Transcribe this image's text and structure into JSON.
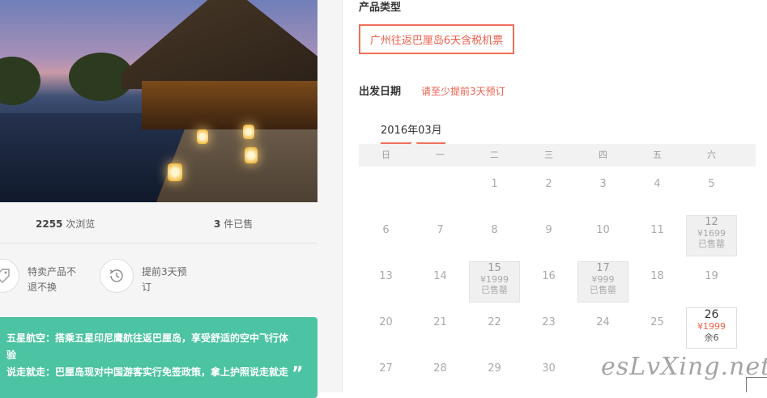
{
  "stats": {
    "views_count": "2255",
    "views_label": "次浏览",
    "sold_count": "3",
    "sold_label": "件已售"
  },
  "features": [
    {
      "icon": "tag-icon",
      "text": "特卖产品不退不换"
    },
    {
      "icon": "clock-history-icon",
      "text": "提前3天预订"
    }
  ],
  "notice": {
    "line1": "五星航空：搭乘五星印尼鹰航往返巴厘岛，享受舒适的空中飞行体验",
    "line2": "说走就走：巴厘岛现对中国游客实行免签政策，拿上护照说走就走"
  },
  "product": {
    "section_title": "产品类型",
    "option_label": "广州往返巴厘岛6天含税机票"
  },
  "date": {
    "section_title": "出发日期",
    "hint": "请至少提前3天预订",
    "month_tab": "2016年03月",
    "weekdays": [
      "日",
      "一",
      "二",
      "三",
      "四",
      "五",
      "六"
    ],
    "rows": [
      [
        {
          "d": ""
        },
        {
          "d": ""
        },
        {
          "d": "1"
        },
        {
          "d": "2"
        },
        {
          "d": "3"
        },
        {
          "d": "4"
        },
        {
          "d": "5"
        }
      ],
      [
        {
          "d": "6"
        },
        {
          "d": "7"
        },
        {
          "d": "8"
        },
        {
          "d": "9"
        },
        {
          "d": "10"
        },
        {
          "d": "11"
        },
        {
          "d": "12",
          "price": "¥1699",
          "status": "已售罄",
          "state": "soldout"
        }
      ],
      [
        {
          "d": "13"
        },
        {
          "d": "14"
        },
        {
          "d": "15",
          "price": "¥1999",
          "status": "已售罄",
          "state": "soldout"
        },
        {
          "d": "16"
        },
        {
          "d": "17",
          "price": "¥999",
          "status": "已售罄",
          "state": "soldout"
        },
        {
          "d": "18"
        },
        {
          "d": "19"
        }
      ],
      [
        {
          "d": "20"
        },
        {
          "d": "21"
        },
        {
          "d": "22"
        },
        {
          "d": "23"
        },
        {
          "d": "24"
        },
        {
          "d": "25"
        },
        {
          "d": "26",
          "price": "¥1999",
          "status": "余6",
          "state": "avail"
        }
      ],
      [
        {
          "d": "27"
        },
        {
          "d": "28"
        },
        {
          "d": "29"
        },
        {
          "d": "30"
        },
        {
          "d": ""
        },
        {
          "d": ""
        },
        {
          "d": ""
        }
      ]
    ]
  },
  "watermark": "esLvXing.net",
  "colors": {
    "accent": "#ef5f4a",
    "notice_bg": "#4cc3a2"
  }
}
